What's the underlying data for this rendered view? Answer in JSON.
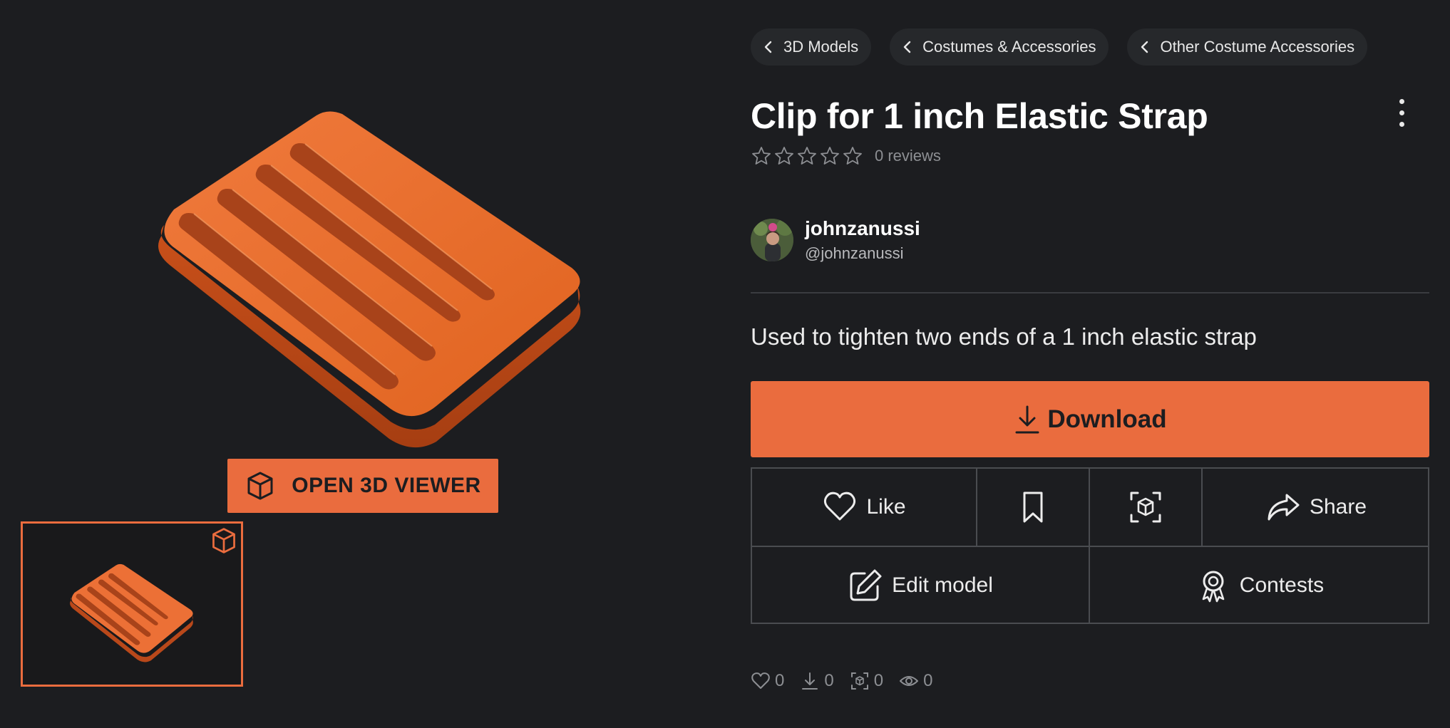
{
  "colors": {
    "background": "#1c1d20",
    "accent": "#ea6c3e",
    "border": "#4a4c50",
    "muted": "#8d8f93"
  },
  "media": {
    "viewer_button_label": "OPEN 3D VIEWER",
    "viewer_button_icon": "cube-icon",
    "thumbnail_badge_icon": "cube-icon"
  },
  "breadcrumbs": [
    {
      "label": "3D Models",
      "icon": "chevron-left-icon"
    },
    {
      "label": "Costumes & Accessories",
      "icon": "chevron-left-icon"
    },
    {
      "label": "Other Costume Accessories",
      "icon": "chevron-left-icon"
    }
  ],
  "model": {
    "title": "Clip for 1 inch Elastic Strap",
    "rating_stars": 0,
    "rating_max": 5,
    "review_count_text": "0 reviews",
    "description": "Used to tighten two ends of a 1 inch elastic strap"
  },
  "author": {
    "name": "johnzanussi",
    "handle": "@johnzanussi"
  },
  "actions": {
    "download_label": "Download",
    "like_label": "Like",
    "share_label": "Share",
    "edit_label": "Edit model",
    "contests_label": "Contests"
  },
  "stats": {
    "likes": "0",
    "downloads": "0",
    "makes": "0",
    "views": "0"
  }
}
